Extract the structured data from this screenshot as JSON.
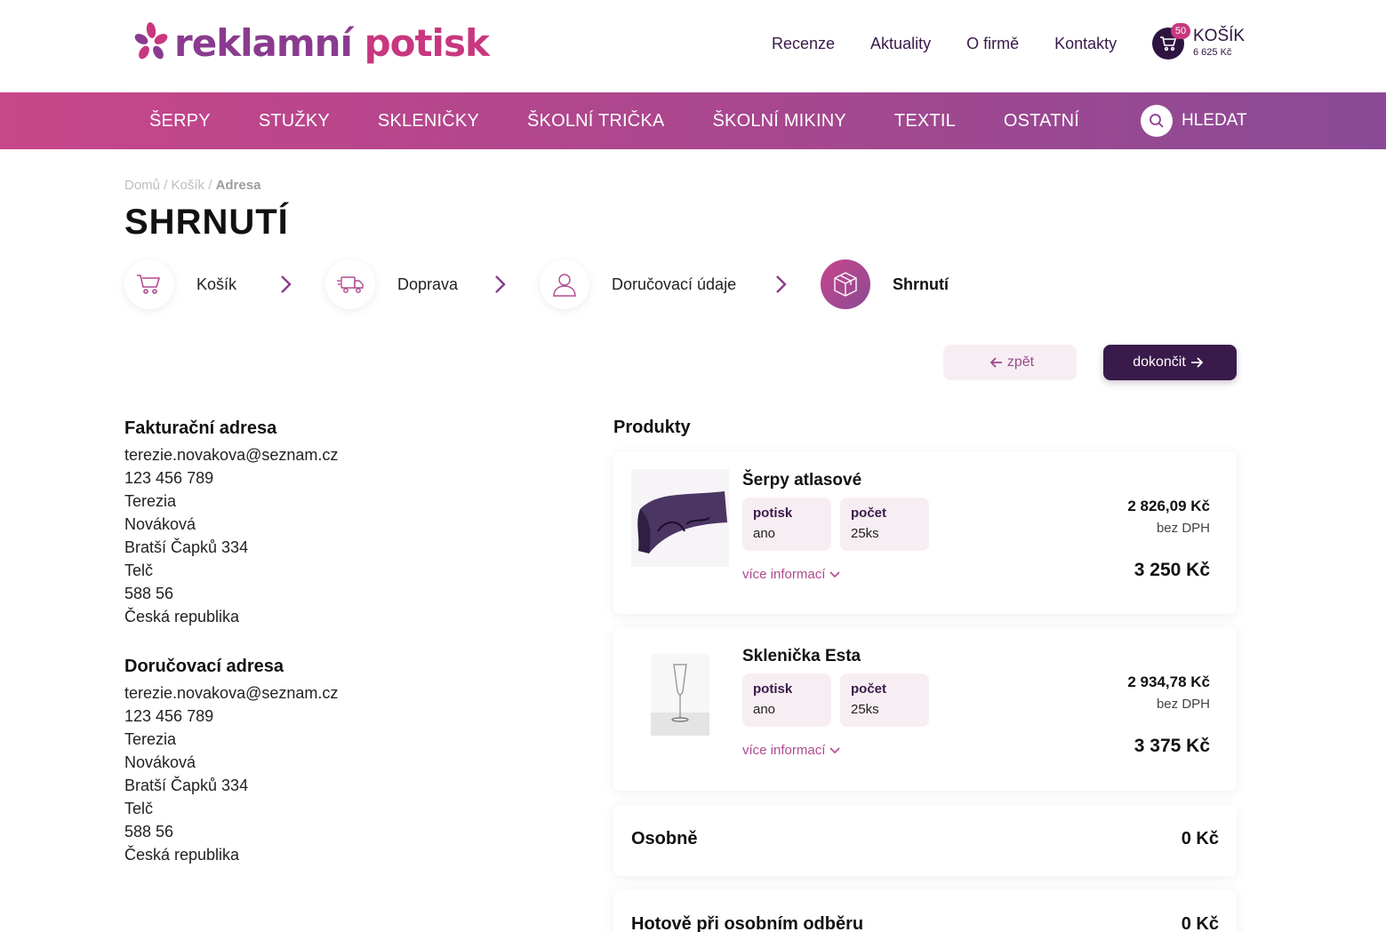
{
  "brand": {
    "name_part1": "reklamní",
    "name_part2": "potisk"
  },
  "top_nav": [
    "Recenze",
    "Aktuality",
    "O firmě",
    "Kontakty"
  ],
  "cart": {
    "label": "KOŠÍK",
    "count": "50",
    "total": "6 625 Kč"
  },
  "categories": [
    "ŠERPY",
    "STUŽKY",
    "SKLENIČKY",
    "ŠKOLNÍ TRIČKA",
    "ŠKOLNÍ MIKINY",
    "TEXTIL",
    "OSTATNÍ"
  ],
  "search": {
    "label": "HLEDAT"
  },
  "breadcrumb": {
    "home": "Domů",
    "cart": "Košík",
    "current": "Adresa",
    "sep": "/"
  },
  "page_title": "SHRNUTÍ",
  "steps": [
    {
      "label": "Košík",
      "icon": "cart-icon"
    },
    {
      "label": "Doprava",
      "icon": "truck-icon"
    },
    {
      "label": "Doručovací údaje",
      "icon": "user-icon"
    },
    {
      "label": "Shrnutí",
      "icon": "box-icon",
      "active": true
    }
  ],
  "buttons": {
    "back": "zpět",
    "finish": "dokončit"
  },
  "billing": {
    "title": "Fakturační adresa",
    "lines": [
      "terezie.novakova@seznam.cz",
      "123 456 789",
      "Terezia",
      "Nováková",
      "Bratší Čapků 334",
      "Telč",
      "588 56",
      "Česká republika"
    ]
  },
  "delivery": {
    "title": "Doručovací adresa",
    "lines": [
      "terezie.novakova@seznam.cz",
      "123 456 789",
      "Terezia",
      "Nováková",
      "Bratší Čapků 334",
      "Telč",
      "588 56",
      "Česká republika"
    ]
  },
  "products_title": "Produkty",
  "products": [
    {
      "name": "Šerpy atlasové",
      "attrs": [
        {
          "key": "potisk",
          "value": "ano"
        },
        {
          "key": "počet",
          "value": "25ks"
        }
      ],
      "more": "více informací",
      "price_net": "2 826,09 Kč",
      "price_net_label": "bez DPH",
      "price_gross": "3 250 Kč"
    },
    {
      "name": "Sklenička Esta",
      "attrs": [
        {
          "key": "potisk",
          "value": "ano"
        },
        {
          "key": "počet",
          "value": "25ks"
        }
      ],
      "more": "více informací",
      "price_net": "2 934,78 Kč",
      "price_net_label": "bez DPH",
      "price_gross": "3 375 Kč"
    }
  ],
  "summary": [
    {
      "label": "Osobně",
      "value": "0 Kč"
    },
    {
      "label": "Hotově při osobním odběru",
      "value": "0 Kč"
    }
  ],
  "colors": {
    "primary": "#c8377f",
    "secondary": "#8a3b8f",
    "dark": "#3a1a4a"
  }
}
